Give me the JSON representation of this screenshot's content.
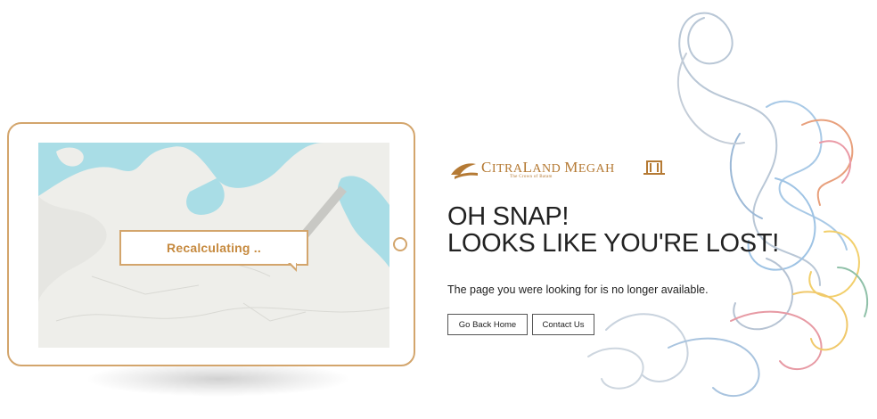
{
  "tablet": {
    "callout_text": "Recalculating ..",
    "icons": [
      "map",
      "home-button"
    ]
  },
  "brand": {
    "logo_word_1_initial": "C",
    "logo_word_1_rest": "ITRA",
    "logo_word_2_initial": "L",
    "logo_word_2_rest": "AND",
    "logo_word_3_initial": "M",
    "logo_word_3_rest": "EGAH",
    "tagline": "The Crown of Batam",
    "color": "#b57a34"
  },
  "message": {
    "headline_line1": "OH SNAP!",
    "headline_line2": "LOOKS LIKE YOU'RE LOST!",
    "subtext": "The page you were looking for is no longer available."
  },
  "actions": {
    "home_label": "Go Back Home",
    "contact_label": "Contact Us"
  },
  "colors": {
    "accent": "#d3a56c",
    "text": "#222222",
    "map_water": "#a9dde6",
    "map_land": "#eeeeea"
  }
}
